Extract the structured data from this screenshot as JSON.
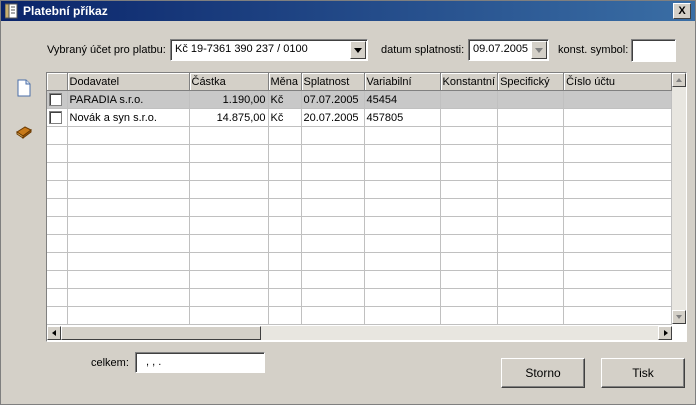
{
  "window": {
    "title": "Platební příkaz",
    "close_label": "X"
  },
  "form": {
    "account_label": "Vybraný účet pro platbu:",
    "account_value": "Kč  19-7361 390 237 / 0100",
    "due_label": "datum splatnosti:",
    "due_value": "09.07.2005",
    "const_label": "konst. symbol:",
    "const_value": ""
  },
  "grid": {
    "columns": [
      "Dodavatel",
      "Částka",
      "Měna",
      "Splatnost",
      "Variabilní",
      "Konstantní",
      "Specifický",
      "Číslo účtu"
    ],
    "rows": [
      {
        "checked": false,
        "cells": [
          "PARADIA s.r.o.",
          "1.190,00",
          "Kč",
          "07.07.2005",
          "45454",
          "",
          "",
          ""
        ]
      },
      {
        "checked": false,
        "cells": [
          "Novák a syn s.r.o.",
          "14.875,00",
          "Kč",
          "20.07.2005",
          "457805",
          "",
          "",
          ""
        ]
      }
    ],
    "empty_rows": 11
  },
  "footer": {
    "total_label": "celkem:",
    "total_value": " ,  ,  .",
    "cancel_label": "Storno",
    "print_label": "Tisk"
  },
  "icons": {
    "app": "scroll-document-icon",
    "new": "new-document-icon",
    "book": "book-icon"
  }
}
